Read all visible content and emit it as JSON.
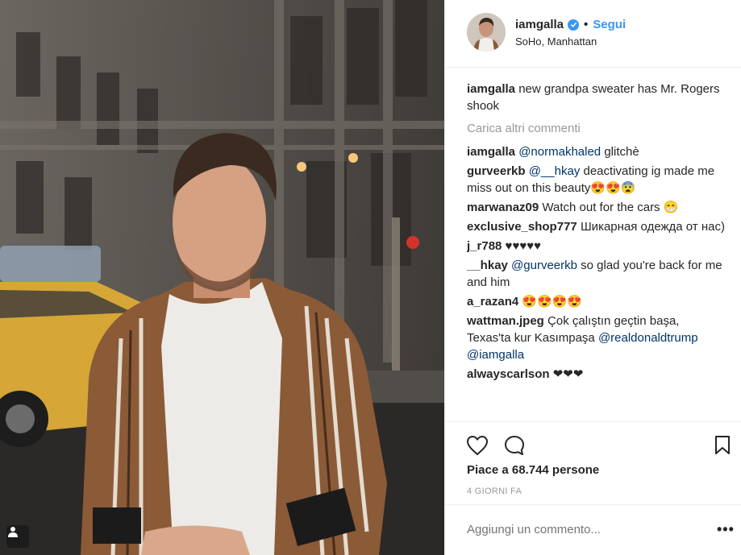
{
  "post": {
    "username": "iamgalla",
    "follow_label": "Segui",
    "dot": "•",
    "location": "SoHo, Manhattan",
    "caption": {
      "user": "iamgalla",
      "text": "new grandpa sweater has Mr. Rogers shook"
    },
    "load_more": "Carica altri commenti",
    "comments": [
      {
        "user": "iamgalla",
        "mention": "@normakhaled",
        "text": " glitchè"
      },
      {
        "user": "gurveerkb",
        "mention": "@__hkay",
        "text": " deactivating ig made me miss out on this beauty😍😍😨"
      },
      {
        "user": "marwanaz09",
        "mention": "",
        "text": "Watch out for the cars 😁"
      },
      {
        "user": "exclusive_shop777",
        "mention": "",
        "text": "Шикарная одежда от нас)"
      },
      {
        "user": "j_r788",
        "mention": "",
        "text": "♥♥♥♥♥"
      },
      {
        "user": "__hkay",
        "mention": "@gurveerkb",
        "text": " so glad you're back for me and him"
      },
      {
        "user": "a_razan4",
        "mention": "",
        "text": "😍😍😍😍"
      },
      {
        "user": "wattman.jpeg",
        "mention": "",
        "text": "Çok çalıştın geçtin başa, Texas'ta kur Kasımpaşa ",
        "mention2": "@realdonaldtrump",
        "mention3": "@iamgalla"
      },
      {
        "user": "alwayscarlson",
        "mention": "",
        "text": "❤❤❤"
      }
    ],
    "likes": "Piace a 68.744 persone",
    "timestamp": "4 GIORNI FA",
    "add_comment_placeholder": "Aggiungi un commento...",
    "more_label": "•••"
  },
  "icons": {
    "like": "heart-icon",
    "comment": "comment-icon",
    "save": "bookmark-icon",
    "verified": "verified-badge-icon",
    "tag": "user-tag-icon"
  },
  "colors": {
    "accent": "#3897f0",
    "mention": "#003569",
    "muted": "#999999"
  }
}
